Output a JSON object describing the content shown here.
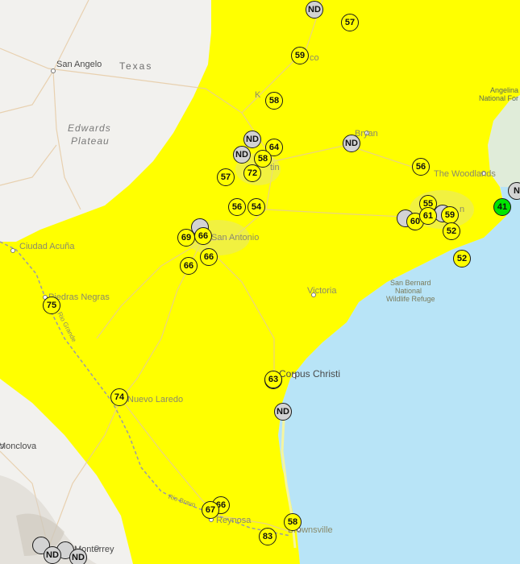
{
  "map": {
    "colors": {
      "land": "#f2f1ee",
      "water": "#b8e4f7",
      "moderate_zone": "#ffff00",
      "good": "#00e400",
      "no_data": "#d3d3d3"
    },
    "labels": {
      "san_angelo": "San Angelo",
      "texas": "Texas",
      "edwards": "Edwards",
      "plateau": "Plateau",
      "bryan": "Bryan",
      "the_woodlands": "The Woodlands",
      "angelina": "Angelina",
      "national_for": "National For",
      "san_antonio": "San Antonio",
      "ciudad_acuna": "Ciudad Acuña",
      "piedras_negras": "Piedras Negras",
      "victoria": "Victoria",
      "san_bernard": "San Bernard",
      "national": "National",
      "wildlife_refuge": "Wildlife Refuge",
      "corpus_christi": "Corpus Christi",
      "nuevo_laredo": "Nuevo Laredo",
      "monclova": "Monclova",
      "reynosa": "Reynosa",
      "brownsville": "Brownsville",
      "monterrey": "Monterrey",
      "waco_frag": "co",
      "killeen_frag": "K",
      "austin_frag": "tin",
      "houston_frag": "n",
      "rio_grande": "Rio Grande",
      "rio_bravo": "Rio Bravo"
    },
    "stations": [
      {
        "aqi": "ND",
        "category": "nd"
      },
      {
        "aqi": "57",
        "category": "moderate"
      },
      {
        "aqi": "59",
        "category": "moderate"
      },
      {
        "aqi": "58",
        "category": "moderate"
      },
      {
        "aqi": "ND",
        "category": "nd"
      },
      {
        "aqi": "64",
        "category": "moderate"
      },
      {
        "aqi": "ND",
        "category": "nd"
      },
      {
        "aqi": "58",
        "category": "moderate"
      },
      {
        "aqi": "72",
        "category": "moderate"
      },
      {
        "aqi": "57",
        "category": "moderate"
      },
      {
        "aqi": "ND",
        "category": "nd"
      },
      {
        "aqi": "56",
        "category": "moderate"
      },
      {
        "aqi": "56",
        "category": "moderate"
      },
      {
        "aqi": "54",
        "category": "moderate"
      },
      {
        "aqi": "69",
        "category": "moderate"
      },
      {
        "aqi": "66",
        "category": "moderate"
      },
      {
        "aqi": "66",
        "category": "moderate"
      },
      {
        "aqi": "66",
        "category": "moderate"
      },
      {
        "aqi": "55",
        "category": "moderate"
      },
      {
        "aqi": "60",
        "category": "moderate"
      },
      {
        "aqi": "61",
        "category": "moderate"
      },
      {
        "aqi": "59",
        "category": "moderate"
      },
      {
        "aqi": "52",
        "category": "moderate"
      },
      {
        "aqi": "52",
        "category": "moderate"
      },
      {
        "aqi": "41",
        "category": "good"
      },
      {
        "aqi": "N",
        "category": "nd"
      },
      {
        "aqi": "75",
        "category": "moderate"
      },
      {
        "aqi": "63",
        "category": "moderate"
      },
      {
        "aqi": "ND",
        "category": "nd"
      },
      {
        "aqi": "74",
        "category": "moderate"
      },
      {
        "aqi": "66",
        "category": "moderate"
      },
      {
        "aqi": "67",
        "category": "moderate"
      },
      {
        "aqi": "58",
        "category": "moderate"
      },
      {
        "aqi": "83",
        "category": "moderate"
      },
      {
        "aqi": "ND",
        "category": "nd"
      },
      {
        "aqi": "ND",
        "category": "nd"
      }
    ]
  }
}
